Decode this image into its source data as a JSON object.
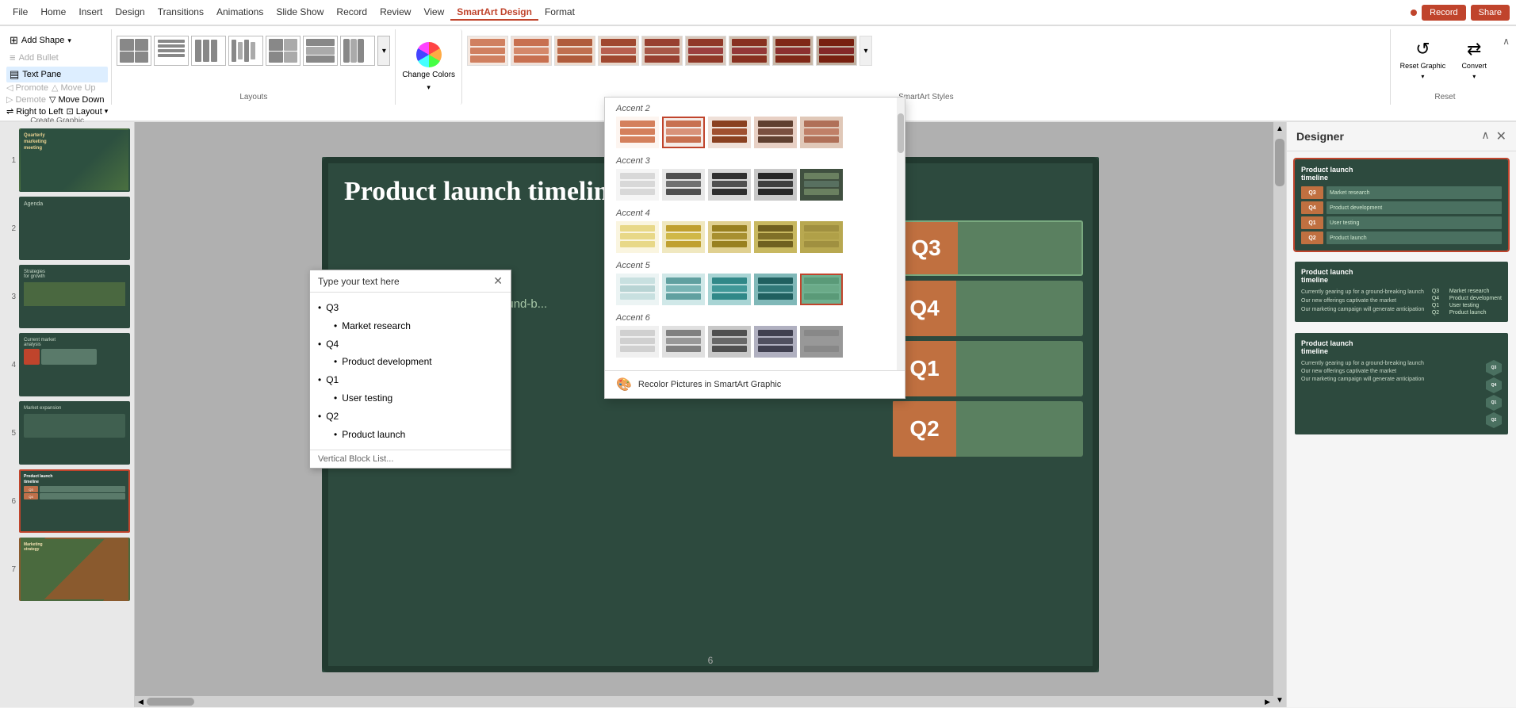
{
  "titlebar": {
    "tabs": [
      "File",
      "Home",
      "Insert",
      "Design",
      "Transitions",
      "Animations",
      "Slide Show",
      "Record",
      "Review",
      "View",
      "SmartArt Design",
      "Format"
    ],
    "active_tab": "SmartArt Design",
    "record_label": "Record",
    "share_label": "Share"
  },
  "ribbon": {
    "create_graphic": {
      "label": "Create Graphic",
      "add_shape_label": "Add Shape",
      "add_bullet_label": "Add Bullet",
      "text_pane_label": "Text Pane",
      "promote_label": "Promote",
      "demote_label": "Demote",
      "move_up_label": "Move Up",
      "move_down_label": "Move Down",
      "right_to_left_label": "Right to Left",
      "layout_label": "Layout"
    },
    "layouts": {
      "label": "Layouts",
      "items": [
        {
          "id": "l1"
        },
        {
          "id": "l2"
        },
        {
          "id": "l3"
        },
        {
          "id": "l4"
        },
        {
          "id": "l5"
        },
        {
          "id": "l6"
        },
        {
          "id": "l7"
        }
      ]
    },
    "change_colors": {
      "label": "Change Colors"
    },
    "smartart_styles": {
      "label": "SmartArt Styles",
      "items": [
        {
          "id": "s1"
        },
        {
          "id": "s2"
        },
        {
          "id": "s3"
        },
        {
          "id": "s4"
        },
        {
          "id": "s5"
        },
        {
          "id": "s6"
        },
        {
          "id": "s7"
        },
        {
          "id": "s8"
        },
        {
          "id": "s9"
        },
        {
          "id": "s10"
        }
      ]
    },
    "reset": {
      "label": "Reset",
      "reset_graphic_label": "Reset Graphic",
      "convert_label": "Convert"
    }
  },
  "color_dropdown": {
    "sections": [
      {
        "id": "accent2",
        "label": "Accent 2",
        "swatches": [
          {
            "id": "a2-1",
            "colors": [
              "#f5c5a0",
              "#f5c5a0",
              "#f5c5a0",
              "#f5c5a0"
            ]
          },
          {
            "id": "a2-2",
            "colors": [
              "#e8a880",
              "#e8c0a0",
              "#f0d0b0",
              "#f5c5a0"
            ],
            "selected": true
          },
          {
            "id": "a2-3",
            "colors": [
              "#c07040",
              "#c07040",
              "#c07040",
              "#c07040"
            ]
          },
          {
            "id": "a2-4",
            "colors": [
              "#804020",
              "#c07040",
              "#e0a070",
              "#f0c090"
            ]
          },
          {
            "id": "a2-5",
            "colors": [
              "#d09070",
              "#d09070",
              "#d09070",
              "#d09070"
            ]
          }
        ]
      },
      {
        "id": "accent3",
        "label": "Accent 3",
        "swatches": [
          {
            "id": "a3-1",
            "colors": [
              "#f0f0f0",
              "#f0f0f0",
              "#f0f0f0",
              "#f0f0f0"
            ]
          },
          {
            "id": "a3-2",
            "colors": [
              "#606060",
              "#606060",
              "#808080",
              "#a0a0a0"
            ]
          },
          {
            "id": "a3-3",
            "colors": [
              "#404040",
              "#606060",
              "#808080",
              "#a0a0a0"
            ]
          },
          {
            "id": "a3-4",
            "colors": [
              "#505050",
              "#505050",
              "#707070",
              "#909090"
            ]
          },
          {
            "id": "a3-5",
            "colors": [
              "#4a5a4a",
              "#4a5a4a",
              "#4a5a4a",
              "#4a5a4a"
            ]
          }
        ]
      },
      {
        "id": "accent4",
        "label": "Accent 4",
        "swatches": [
          {
            "id": "a4-1",
            "colors": [
              "#f0e8c0",
              "#f0e8c0",
              "#f0e8c0",
              "#f0e8c0"
            ]
          },
          {
            "id": "a4-2",
            "colors": [
              "#d4c080",
              "#d4c080",
              "#e0cc90",
              "#ecd8a0"
            ]
          },
          {
            "id": "a4-3",
            "colors": [
              "#c0a840",
              "#c0a840",
              "#c0a840",
              "#c0a840"
            ]
          },
          {
            "id": "a4-4",
            "colors": [
              "#a08030",
              "#b89040",
              "#d0a850",
              "#e8c060"
            ]
          },
          {
            "id": "a4-5",
            "colors": [
              "#b89858",
              "#b89858",
              "#b89858",
              "#b89858"
            ]
          }
        ]
      },
      {
        "id": "accent5",
        "label": "Accent 5",
        "swatches": [
          {
            "id": "a5-1",
            "colors": [
              "#e8f0f0",
              "#e8f0f0",
              "#d0e4e4",
              "#b8d8d8"
            ]
          },
          {
            "id": "a5-2",
            "colors": [
              "#80b0b0",
              "#80b0b0",
              "#a0c4c4",
              "#c0d8d8"
            ]
          },
          {
            "id": "a5-3",
            "colors": [
              "#408888",
              "#408888",
              "#408888",
              "#408888"
            ]
          },
          {
            "id": "a5-4",
            "colors": [
              "#306868",
              "#408888",
              "#50a8a8",
              "#60c8c8"
            ]
          },
          {
            "id": "a5-5",
            "colors": [
              "#6aaa9a",
              "#6aaa9a",
              "#7abb9a",
              "#8acca0"
            ],
            "selected": true
          }
        ]
      },
      {
        "id": "accent6",
        "label": "Accent 6",
        "swatches": [
          {
            "id": "a6-1",
            "colors": [
              "#f0f0f0",
              "#f0f0f0",
              "#e0e0e0",
              "#d0d0d0"
            ]
          },
          {
            "id": "a6-2",
            "colors": [
              "#909090",
              "#909090",
              "#a8a8a8",
              "#c0c0c0"
            ]
          },
          {
            "id": "a6-3",
            "colors": [
              "#606060",
              "#606060",
              "#787878",
              "#909090"
            ]
          },
          {
            "id": "a6-4",
            "colors": [
              "#505060",
              "#606070",
              "#787890",
              "#9090a8"
            ]
          },
          {
            "id": "a6-5",
            "colors": [
              "#888898",
              "#888898",
              "#888898",
              "#888898"
            ]
          }
        ]
      }
    ],
    "recolor_label": "Recolor Pictures in SmartArt Graphic"
  },
  "text_pane": {
    "title": "Type your text here",
    "items": [
      {
        "label": "Q3",
        "children": [
          {
            "label": "Market research"
          }
        ]
      },
      {
        "label": "Q4",
        "children": [
          {
            "label": "Product development"
          }
        ]
      },
      {
        "label": "Q1",
        "children": [
          {
            "label": "User testing"
          }
        ]
      },
      {
        "label": "Q2",
        "children": [
          {
            "label": "Product launch"
          }
        ]
      }
    ],
    "footer": "Vertical Block List..."
  },
  "slide_panel": {
    "slides": [
      {
        "num": 1,
        "label": "Quarterly marketing meeting"
      },
      {
        "num": 2,
        "label": "Agenda"
      },
      {
        "num": 3,
        "label": "Strategies for growth"
      },
      {
        "num": 4,
        "label": "Current market analysis"
      },
      {
        "num": 5,
        "label": "Market expansion"
      },
      {
        "num": 6,
        "label": "Product launch timeline",
        "active": true
      },
      {
        "num": 7,
        "label": "Marketing strategy"
      }
    ]
  },
  "main_slide": {
    "title": "Product launch timeline",
    "bullets": [
      "Currently gearing up for a ground-b...",
      "Our new o... captivate...",
      "Our mark... generate..."
    ],
    "q_items": [
      {
        "label": "Q3",
        "color": "#5a8a6a"
      },
      {
        "label": "Q4",
        "color": "#5a8a6a"
      },
      {
        "label": "Q1",
        "color": "#5a8a6a"
      },
      {
        "label": "Q2",
        "color": "#5a8a6a"
      }
    ],
    "slide_number": "6"
  },
  "designer": {
    "title": "Designer",
    "close_label": "×",
    "collapse_label": "∧",
    "designs": [
      {
        "id": "d1",
        "active": true,
        "title": "Product launch timeline",
        "labels": [
          "Q3",
          "Q4",
          "Q1",
          "Q2"
        ]
      },
      {
        "id": "d2",
        "title": "Product launch timeline",
        "labels": [
          "Q3",
          "Q4",
          "Q1",
          "Q2"
        ]
      },
      {
        "id": "d3",
        "title": "Product launch timeline",
        "labels": [
          "Q3",
          "Q4",
          "Q1",
          "Q2"
        ]
      }
    ]
  }
}
